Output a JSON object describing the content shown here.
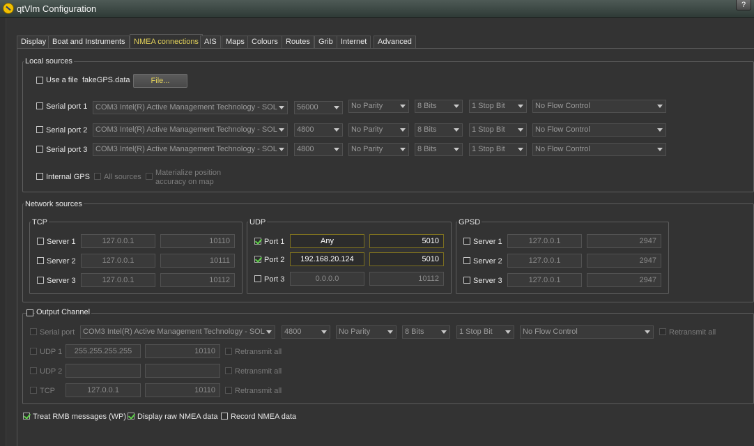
{
  "window": {
    "title": "qtVlm Configuration",
    "help": "?"
  },
  "tabs": [
    "Display",
    "Boat and Instruments",
    "NMEA connections",
    "AIS",
    "Maps",
    "Colours",
    "Routes",
    "Grib",
    "Internet",
    "Advanced"
  ],
  "active_tab": "NMEA connections",
  "local_sources": {
    "title": "Local sources",
    "use_file": {
      "label": "Use a file",
      "filename": "fakeGPS.data",
      "button": "File..."
    },
    "serial_ports": [
      {
        "label": "Serial port 1",
        "port": "COM3 Intel(R) Active Management Technology - SOL",
        "baud": "56000",
        "parity": "No Parity",
        "bits": "8 Bits",
        "stop": "1 Stop Bit",
        "flow": "No Flow Control"
      },
      {
        "label": "Serial port 2",
        "port": "COM3 Intel(R) Active Management Technology - SOL",
        "baud": "4800",
        "parity": "No Parity",
        "bits": "8 Bits",
        "stop": "1 Stop Bit",
        "flow": "No Flow Control"
      },
      {
        "label": "Serial port 3",
        "port": "COM3 Intel(R) Active Management Technology - SOL",
        "baud": "4800",
        "parity": "No Parity",
        "bits": "8 Bits",
        "stop": "1 Stop Bit",
        "flow": "No Flow Control"
      }
    ],
    "internal_gps": {
      "label": "Internal GPS",
      "all_sources": "All sources",
      "materialize_line1": "Materialize position",
      "materialize_line2": "accuracy on map"
    }
  },
  "network_sources": {
    "title": "Network sources",
    "tcp": {
      "title": "TCP",
      "rows": [
        {
          "label": "Server 1",
          "host": "127.0.0.1",
          "port": "10110",
          "checked": false
        },
        {
          "label": "Server 2",
          "host": "127.0.0.1",
          "port": "10111",
          "checked": false
        },
        {
          "label": "Server 3",
          "host": "127.0.0.1",
          "port": "10112",
          "checked": false
        }
      ]
    },
    "udp": {
      "title": "UDP",
      "rows": [
        {
          "label": "Port 1",
          "host": "Any",
          "port": "5010",
          "checked": true
        },
        {
          "label": "Port 2",
          "host": "192.168.20.124",
          "port": "5010",
          "checked": true
        },
        {
          "label": "Port 3",
          "host": "0.0.0.0",
          "port": "10112",
          "checked": false
        }
      ]
    },
    "gpsd": {
      "title": "GPSD",
      "rows": [
        {
          "label": "Server 1",
          "host": "127.0.0.1",
          "port": "2947",
          "checked": false
        },
        {
          "label": "Server 2",
          "host": "127.0.0.1",
          "port": "2947",
          "checked": false
        },
        {
          "label": "Server 3",
          "host": "127.0.0.1",
          "port": "2947",
          "checked": false
        }
      ]
    }
  },
  "output_channel": {
    "title": "Output Channel",
    "serial": {
      "label": "Serial port",
      "port": "COM3 Intel(R) Active Management Technology - SOL",
      "baud": "4800",
      "parity": "No Parity",
      "bits": "8 Bits",
      "stop": "1 Stop Bit",
      "flow": "No Flow Control",
      "retransmit": "Retransmit all"
    },
    "udp1": {
      "label": "UDP 1",
      "host": "255.255.255.255",
      "port": "10110",
      "retransmit": "Retransmit all"
    },
    "udp2": {
      "label": "UDP 2",
      "host": "",
      "port": "",
      "retransmit": "Retransmit all"
    },
    "tcp": {
      "label": "TCP",
      "host": "127.0.0.1",
      "port": "10110",
      "retransmit": "Retransmit all"
    }
  },
  "footer": {
    "treat_rmb": "Treat RMB messages (WP)",
    "display_raw": "Display raw NMEA data",
    "record": "Record NMEA data"
  },
  "colors": {
    "accent": "#e3d25a",
    "check": "#5fd24a"
  }
}
